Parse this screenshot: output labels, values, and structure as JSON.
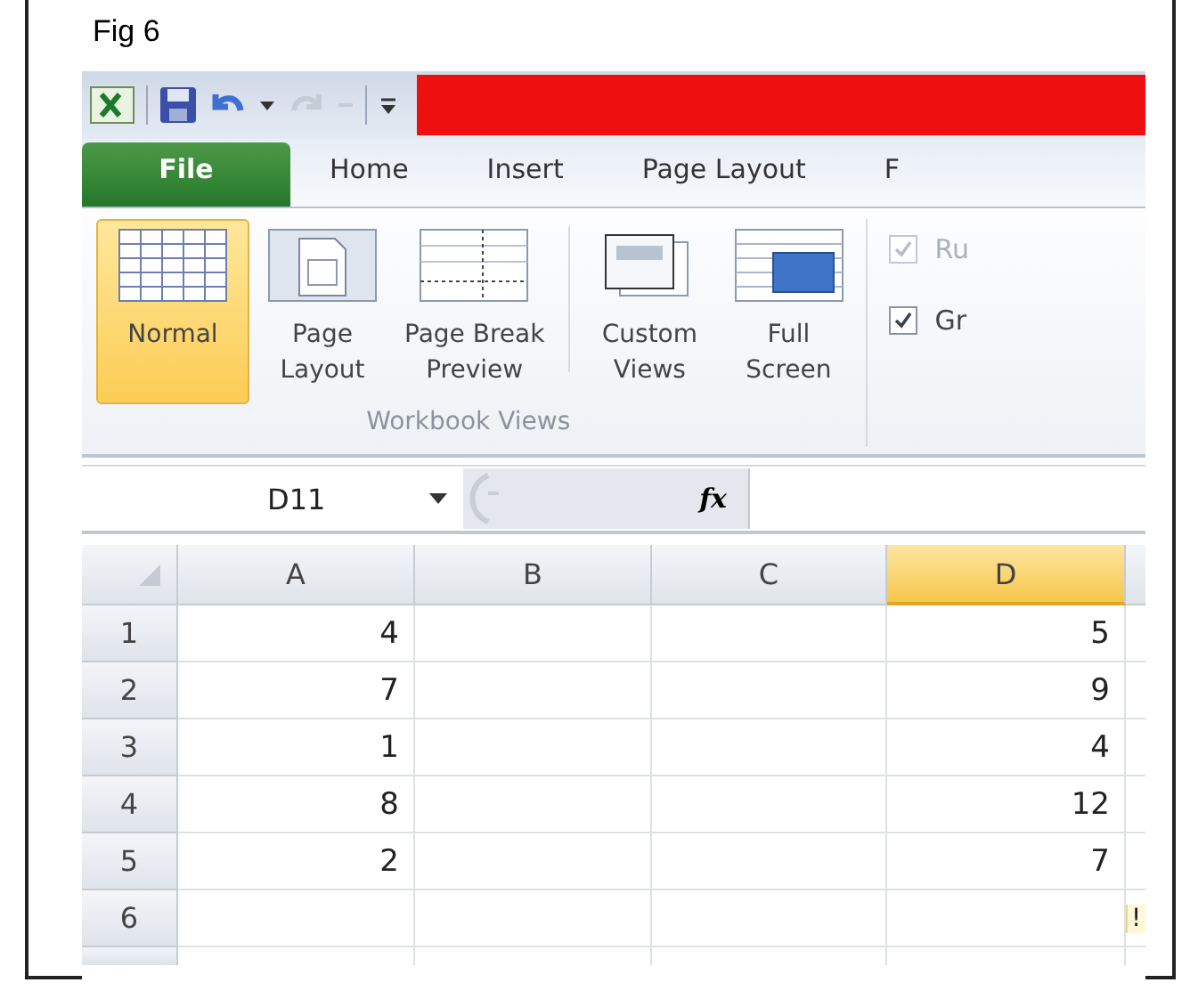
{
  "figure": {
    "label": "Fig 6"
  },
  "tabs": [
    {
      "label": "File",
      "kind": "file"
    },
    {
      "label": "Home",
      "kind": "tab"
    },
    {
      "label": "Insert",
      "kind": "tab"
    },
    {
      "label": "Page Layout",
      "kind": "tab"
    },
    {
      "label": "F",
      "kind": "tab"
    }
  ],
  "ribbon": {
    "group_label": "Workbook Views",
    "buttons": [
      {
        "label": "Normal",
        "kind": "normal",
        "selected": true
      },
      {
        "label": "Page\nLayout",
        "kind": "page",
        "selected": false
      },
      {
        "label": "Page Break\nPreview",
        "kind": "break",
        "selected": false
      },
      {
        "label": "Custom\nViews",
        "kind": "custom",
        "selected": false
      },
      {
        "label": "Full\nScreen",
        "kind": "full",
        "selected": false
      }
    ],
    "checkboxes": [
      {
        "label": "Ru",
        "checked": true,
        "disabled": true
      },
      {
        "label": "Gr",
        "checked": true,
        "disabled": false
      }
    ]
  },
  "formula_bar": {
    "name_box": "D11",
    "function_label": "fx"
  },
  "sheet": {
    "columns": [
      {
        "label": "A",
        "selected": false
      },
      {
        "label": "B",
        "selected": false
      },
      {
        "label": "C",
        "selected": false
      },
      {
        "label": "D",
        "selected": true
      }
    ],
    "rows": [
      {
        "label": "1",
        "a": "4",
        "d": "5"
      },
      {
        "label": "2",
        "a": "7",
        "d": "9"
      },
      {
        "label": "3",
        "a": "1",
        "d": "4"
      },
      {
        "label": "4",
        "a": "8",
        "d": "12"
      },
      {
        "label": "5",
        "a": "2",
        "d": "7"
      },
      {
        "label": "6"
      }
    ],
    "smart_tag": "!"
  }
}
